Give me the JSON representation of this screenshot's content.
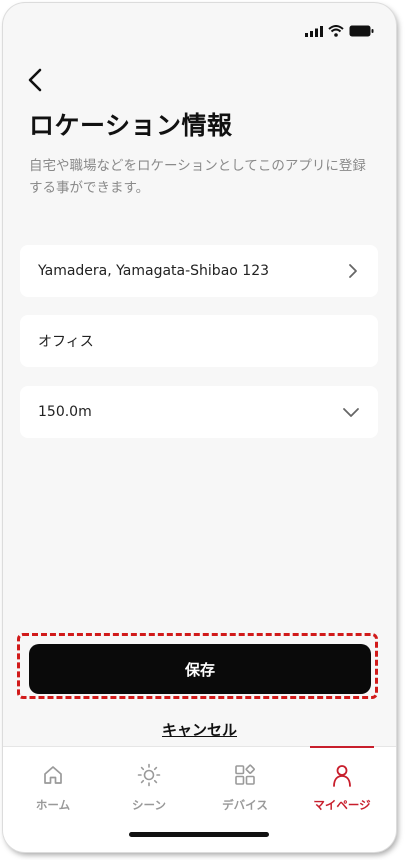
{
  "header": {
    "back_icon": "chevron-left-icon",
    "title": "ロケーション情報",
    "description": "自宅や職場などをロケーションとしてこのアプリに登録する事ができます。"
  },
  "status_bar": {
    "icons": [
      "signal-icon",
      "wifi-icon",
      "battery-icon"
    ]
  },
  "form": {
    "address": {
      "value": "Yamadera, Yamagata-Shibao 123",
      "icon": "chevron-right-icon"
    },
    "name": {
      "value": "オフィス"
    },
    "radius": {
      "value": "150.0m",
      "icon": "chevron-down-icon"
    }
  },
  "actions": {
    "save_label": "保存",
    "cancel_label": "キャンセル"
  },
  "tab_bar": {
    "tabs": [
      {
        "label": "ホーム",
        "icon": "home-icon",
        "active": false
      },
      {
        "label": "シーン",
        "icon": "sun-icon",
        "active": false
      },
      {
        "label": "デバイス",
        "icon": "devices-icon",
        "active": false
      },
      {
        "label": "マイページ",
        "icon": "person-icon",
        "active": true
      }
    ]
  },
  "colors": {
    "accent": "#c81e2c",
    "highlight_border": "#d11a1a",
    "background": "#f7f7f7",
    "primary_button": "#0a0a0a"
  }
}
